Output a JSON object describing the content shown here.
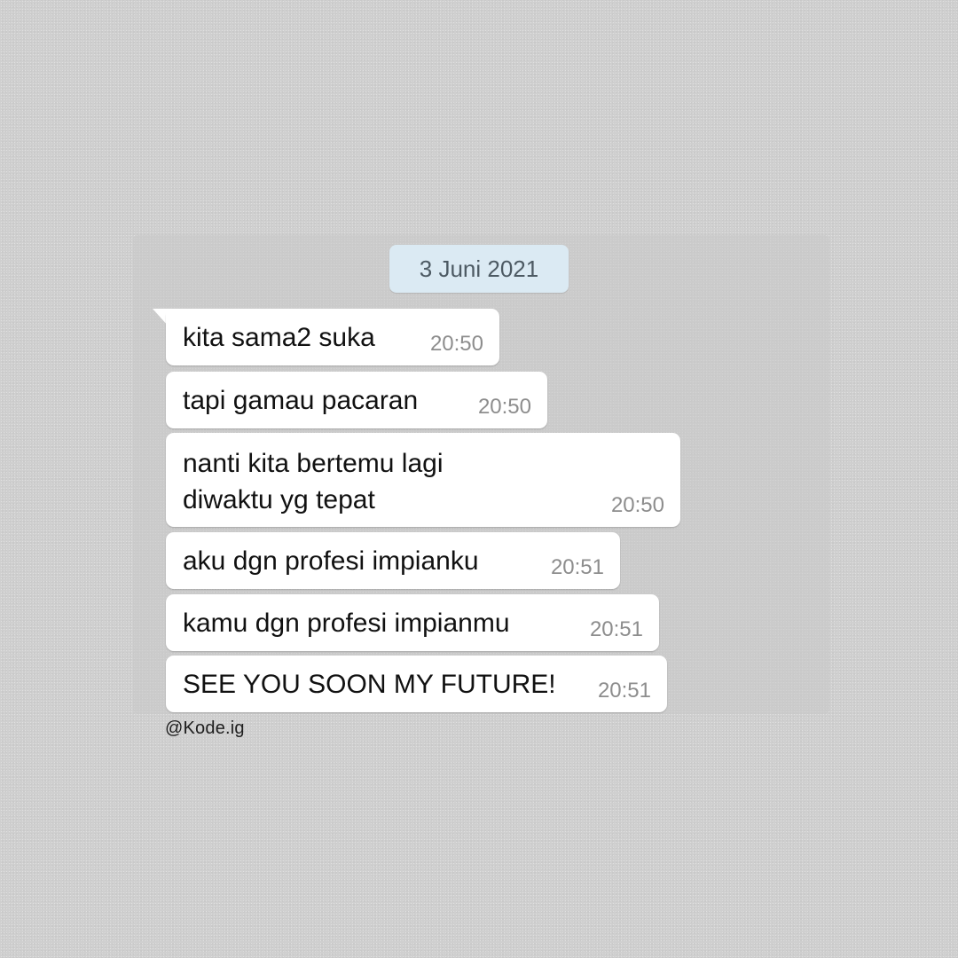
{
  "date_chip": "3 Juni 2021",
  "messages": [
    {
      "text": "kita sama2 suka",
      "time": "20:50"
    },
    {
      "text": "tapi gamau pacaran",
      "time": "20:50"
    },
    {
      "text": "nanti kita bertemu lagi\ndiwaktu yg tepat",
      "time": "20:50"
    },
    {
      "text": "aku dgn profesi impianku",
      "time": "20:51"
    },
    {
      "text": "kamu dgn profesi impianmu",
      "time": "20:51"
    },
    {
      "text": "SEE YOU SOON MY FUTURE!",
      "time": "20:51"
    }
  ],
  "watermark": "@Kode.ig",
  "colors": {
    "background": "#cfcfcf",
    "bubble": "#ffffff",
    "date_chip": "#dbeaf3",
    "timestamp": "#8d8d8d"
  }
}
